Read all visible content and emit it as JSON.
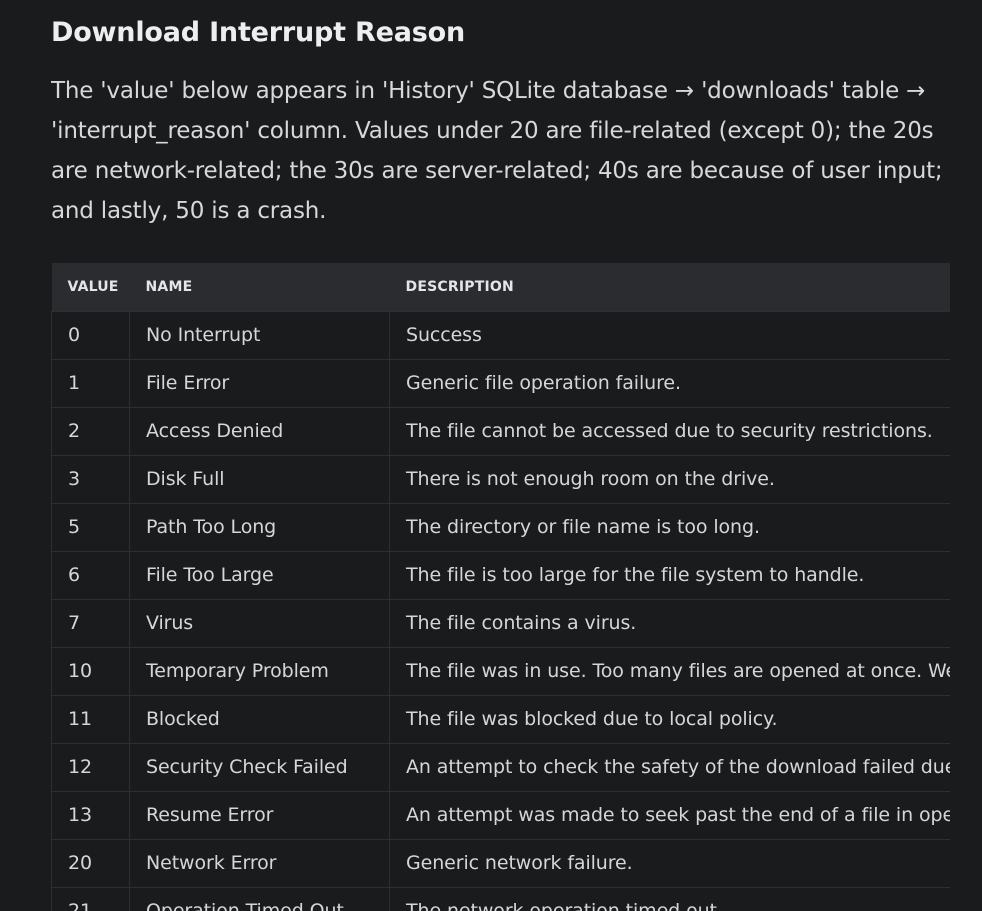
{
  "heading": "Download Interrupt Reason",
  "intro": "The 'value' below appears in 'History' SQLite database → 'downloads' table → 'interrupt_reason' column. Values under 20 are file-related (except 0); the 20s are network-related; the 30s are server-related; 40s are because of user input; and lastly, 50 is a crash.",
  "table": {
    "headers": {
      "value": "VALUE",
      "name": "NAME",
      "description": "DESCRIPTION"
    },
    "rows": [
      {
        "value": "0",
        "name": "No Interrupt",
        "description": "Success"
      },
      {
        "value": "1",
        "name": "File Error",
        "description": "Generic file operation failure."
      },
      {
        "value": "2",
        "name": "Access Denied",
        "description": "The file cannot be accessed due to security restrictions."
      },
      {
        "value": "3",
        "name": "Disk Full",
        "description": "There is not enough room on the drive."
      },
      {
        "value": "5",
        "name": "Path Too Long",
        "description": "The directory or file name is too long."
      },
      {
        "value": "6",
        "name": "File Too Large",
        "description": "The file is too large for the file system to handle."
      },
      {
        "value": "7",
        "name": "Virus",
        "description": "The file contains a virus."
      },
      {
        "value": "10",
        "name": "Temporary Problem",
        "description": "The file was in use. Too many files are opened at once. We hav"
      },
      {
        "value": "11",
        "name": "Blocked",
        "description": "The file was blocked due to local policy."
      },
      {
        "value": "12",
        "name": "Security Check Failed",
        "description": "An attempt to check the safety of the download failed due to u"
      },
      {
        "value": "13",
        "name": "Resume Error",
        "description": "An attempt was made to seek past the end of a file in opening"
      },
      {
        "value": "20",
        "name": "Network Error",
        "description": "Generic network failure."
      },
      {
        "value": "21",
        "name": "Operation Timed Out",
        "description": "The network operation timed out."
      }
    ]
  }
}
